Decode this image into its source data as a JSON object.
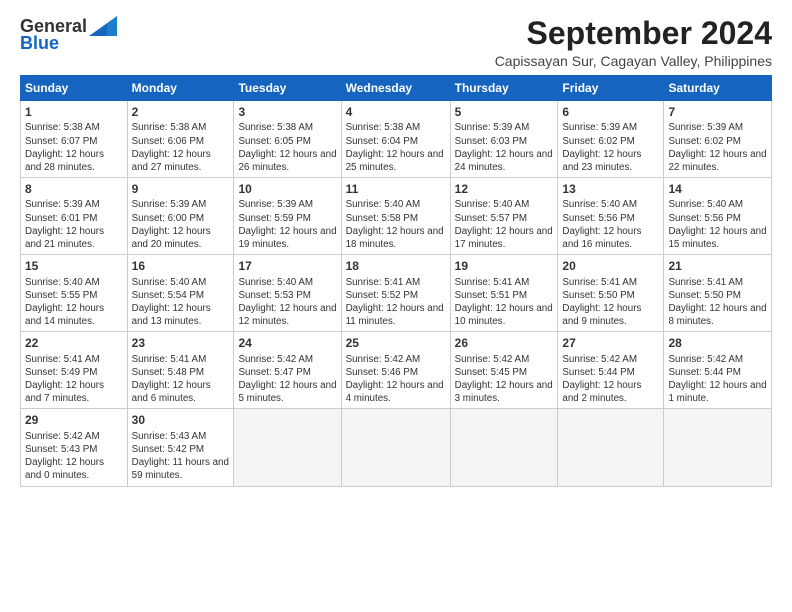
{
  "header": {
    "logo_line1": "General",
    "logo_line2": "Blue",
    "month": "September 2024",
    "location": "Capissayan Sur, Cagayan Valley, Philippines"
  },
  "weekdays": [
    "Sunday",
    "Monday",
    "Tuesday",
    "Wednesday",
    "Thursday",
    "Friday",
    "Saturday"
  ],
  "weeks": [
    [
      {
        "day": "1",
        "sunrise": "5:38 AM",
        "sunset": "6:07 PM",
        "daylight": "12 hours and 28 minutes."
      },
      {
        "day": "2",
        "sunrise": "5:38 AM",
        "sunset": "6:06 PM",
        "daylight": "12 hours and 27 minutes."
      },
      {
        "day": "3",
        "sunrise": "5:38 AM",
        "sunset": "6:05 PM",
        "daylight": "12 hours and 26 minutes."
      },
      {
        "day": "4",
        "sunrise": "5:38 AM",
        "sunset": "6:04 PM",
        "daylight": "12 hours and 25 minutes."
      },
      {
        "day": "5",
        "sunrise": "5:39 AM",
        "sunset": "6:03 PM",
        "daylight": "12 hours and 24 minutes."
      },
      {
        "day": "6",
        "sunrise": "5:39 AM",
        "sunset": "6:02 PM",
        "daylight": "12 hours and 23 minutes."
      },
      {
        "day": "7",
        "sunrise": "5:39 AM",
        "sunset": "6:02 PM",
        "daylight": "12 hours and 22 minutes."
      }
    ],
    [
      {
        "day": "8",
        "sunrise": "5:39 AM",
        "sunset": "6:01 PM",
        "daylight": "12 hours and 21 minutes."
      },
      {
        "day": "9",
        "sunrise": "5:39 AM",
        "sunset": "6:00 PM",
        "daylight": "12 hours and 20 minutes."
      },
      {
        "day": "10",
        "sunrise": "5:39 AM",
        "sunset": "5:59 PM",
        "daylight": "12 hours and 19 minutes."
      },
      {
        "day": "11",
        "sunrise": "5:40 AM",
        "sunset": "5:58 PM",
        "daylight": "12 hours and 18 minutes."
      },
      {
        "day": "12",
        "sunrise": "5:40 AM",
        "sunset": "5:57 PM",
        "daylight": "12 hours and 17 minutes."
      },
      {
        "day": "13",
        "sunrise": "5:40 AM",
        "sunset": "5:56 PM",
        "daylight": "12 hours and 16 minutes."
      },
      {
        "day": "14",
        "sunrise": "5:40 AM",
        "sunset": "5:56 PM",
        "daylight": "12 hours and 15 minutes."
      }
    ],
    [
      {
        "day": "15",
        "sunrise": "5:40 AM",
        "sunset": "5:55 PM",
        "daylight": "12 hours and 14 minutes."
      },
      {
        "day": "16",
        "sunrise": "5:40 AM",
        "sunset": "5:54 PM",
        "daylight": "12 hours and 13 minutes."
      },
      {
        "day": "17",
        "sunrise": "5:40 AM",
        "sunset": "5:53 PM",
        "daylight": "12 hours and 12 minutes."
      },
      {
        "day": "18",
        "sunrise": "5:41 AM",
        "sunset": "5:52 PM",
        "daylight": "12 hours and 11 minutes."
      },
      {
        "day": "19",
        "sunrise": "5:41 AM",
        "sunset": "5:51 PM",
        "daylight": "12 hours and 10 minutes."
      },
      {
        "day": "20",
        "sunrise": "5:41 AM",
        "sunset": "5:50 PM",
        "daylight": "12 hours and 9 minutes."
      },
      {
        "day": "21",
        "sunrise": "5:41 AM",
        "sunset": "5:50 PM",
        "daylight": "12 hours and 8 minutes."
      }
    ],
    [
      {
        "day": "22",
        "sunrise": "5:41 AM",
        "sunset": "5:49 PM",
        "daylight": "12 hours and 7 minutes."
      },
      {
        "day": "23",
        "sunrise": "5:41 AM",
        "sunset": "5:48 PM",
        "daylight": "12 hours and 6 minutes."
      },
      {
        "day": "24",
        "sunrise": "5:42 AM",
        "sunset": "5:47 PM",
        "daylight": "12 hours and 5 minutes."
      },
      {
        "day": "25",
        "sunrise": "5:42 AM",
        "sunset": "5:46 PM",
        "daylight": "12 hours and 4 minutes."
      },
      {
        "day": "26",
        "sunrise": "5:42 AM",
        "sunset": "5:45 PM",
        "daylight": "12 hours and 3 minutes."
      },
      {
        "day": "27",
        "sunrise": "5:42 AM",
        "sunset": "5:44 PM",
        "daylight": "12 hours and 2 minutes."
      },
      {
        "day": "28",
        "sunrise": "5:42 AM",
        "sunset": "5:44 PM",
        "daylight": "12 hours and 1 minute."
      }
    ],
    [
      {
        "day": "29",
        "sunrise": "5:42 AM",
        "sunset": "5:43 PM",
        "daylight": "12 hours and 0 minutes."
      },
      {
        "day": "30",
        "sunrise": "5:43 AM",
        "sunset": "5:42 PM",
        "daylight": "11 hours and 59 minutes."
      },
      null,
      null,
      null,
      null,
      null
    ]
  ]
}
